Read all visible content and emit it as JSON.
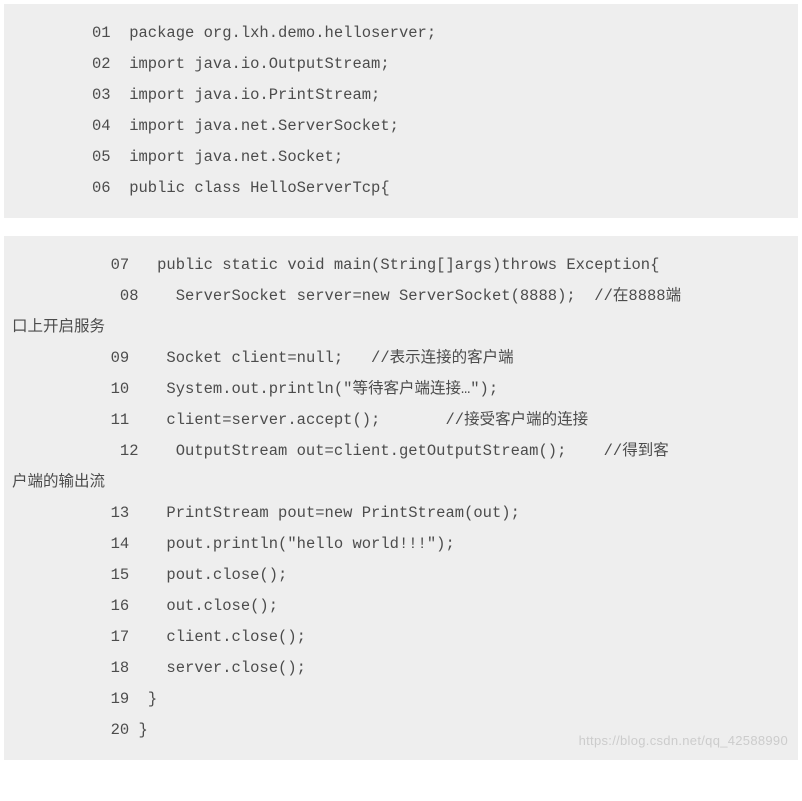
{
  "block1": {
    "l1": "01  package org.lxh.demo.helloserver;",
    "l2": "02  import java.io.OutputStream;",
    "l3": "03  import java.io.PrintStream;",
    "l4": "04  import java.net.ServerSocket;",
    "l5": "05  import java.net.Socket;",
    "l6": "06  public class HelloServerTcp{"
  },
  "block2": {
    "l7": "  07   public static void main(String[]args)throws Exception{",
    "l8": "   08    ServerSocket server=new ServerSocket(8888);  //在8888端",
    "l8b": "口上开启服务",
    "l9": "  09    Socket client=null;   //表示连接的客户端",
    "l10": "  10    System.out.println(\"等待客户端连接…\");",
    "l11": "  11    client=server.accept();       //接受客户端的连接",
    "l12": "   12    OutputStream out=client.getOutputStream();    //得到客",
    "l12b": "户端的输出流",
    "l13": "  13    PrintStream pout=new PrintStream(out);",
    "l14": "  14    pout.println(\"hello world!!!\");",
    "l15": "  15    pout.close();",
    "l16": "  16    out.close();",
    "l17": "  17    client.close();",
    "l18": "  18    server.close();",
    "l19": "  19  }",
    "l20": "  20 }"
  },
  "watermark": "https://blog.csdn.net/qq_42588990"
}
